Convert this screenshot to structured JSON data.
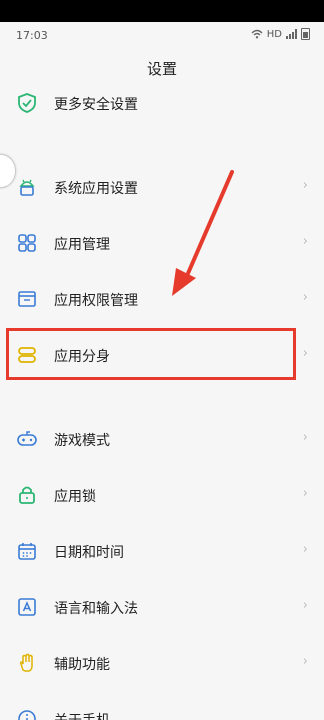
{
  "status": {
    "time": "17:03",
    "network": "HD"
  },
  "header": {
    "title": "设置"
  },
  "menu": {
    "items": [
      {
        "label": "更多安全设置",
        "icon": "shield-check-icon"
      },
      {
        "label": "系统应用设置",
        "icon": "android-icon"
      },
      {
        "label": "应用管理",
        "icon": "apps-grid-icon"
      },
      {
        "label": "应用权限管理",
        "icon": "window-icon"
      },
      {
        "label": "应用分身",
        "icon": "app-clone-icon"
      },
      {
        "label": "游戏模式",
        "icon": "gamepad-icon"
      },
      {
        "label": "应用锁",
        "icon": "lock-icon"
      },
      {
        "label": "日期和时间",
        "icon": "calendar-icon"
      },
      {
        "label": "语言和输入法",
        "icon": "language-icon"
      },
      {
        "label": "辅助功能",
        "icon": "hand-icon"
      },
      {
        "label": "关于手机",
        "icon": "info-icon"
      }
    ],
    "chevron": "›"
  },
  "colors": {
    "highlight": "#e53a2c",
    "icon": "#3a7bd5",
    "app_clone": "#e0b400",
    "shield": "#2bb673",
    "lock": "#2bb673"
  }
}
